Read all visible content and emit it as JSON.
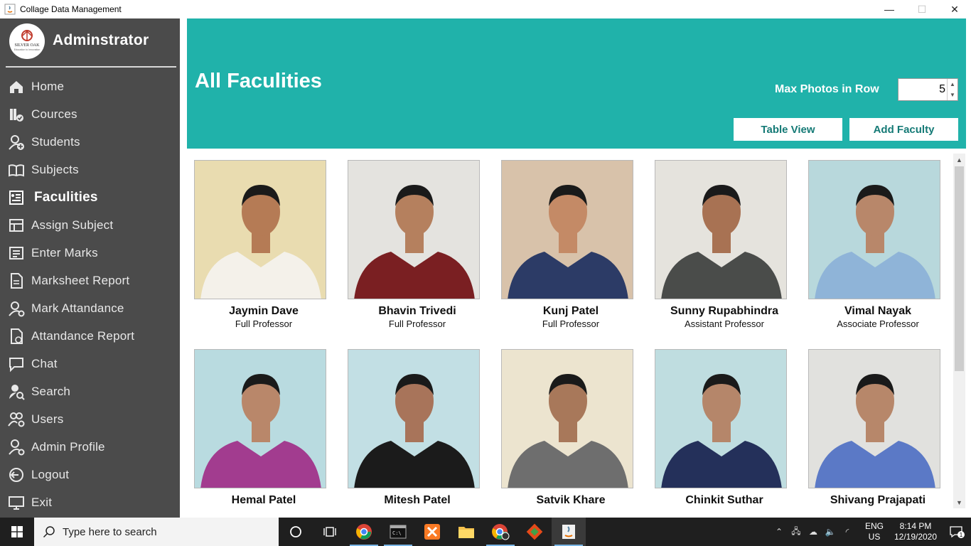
{
  "window": {
    "title": "Collage Data Management",
    "close": "✕",
    "maximize": "☐",
    "minimize": "—"
  },
  "sidebar": {
    "heading": "Adminstrator",
    "items": [
      {
        "label": "Home",
        "icon": "home-icon"
      },
      {
        "label": "Cources",
        "icon": "books-icon"
      },
      {
        "label": "Students",
        "icon": "student-icon"
      },
      {
        "label": "Subjects",
        "icon": "book-open-icon"
      },
      {
        "label": "Faculities",
        "icon": "faculty-icon",
        "active": true
      },
      {
        "label": "Assign Subject",
        "icon": "assign-icon"
      },
      {
        "label": "Enter Marks",
        "icon": "marks-icon"
      },
      {
        "label": "Marksheet Report",
        "icon": "report-icon"
      },
      {
        "label": "Mark Attandance",
        "icon": "attendance-icon"
      },
      {
        "label": "Attandance Report",
        "icon": "attendance-report-icon"
      },
      {
        "label": "Chat",
        "icon": "chat-icon"
      },
      {
        "label": "Search",
        "icon": "search-user-icon"
      },
      {
        "label": "Users",
        "icon": "users-icon"
      },
      {
        "label": "Admin Profile",
        "icon": "admin-profile-icon"
      },
      {
        "label": "Logout",
        "icon": "logout-icon"
      },
      {
        "label": "Exit",
        "icon": "exit-icon"
      }
    ]
  },
  "header": {
    "title": "All Faculities",
    "max_label": "Max Photos in Row",
    "max_value": "5",
    "table_view": "Table View",
    "add_faculty": "Add Faculty",
    "color": "#20b2aa"
  },
  "faculties": [
    {
      "name": "Jaymin Dave",
      "role": "Full Professor",
      "bg": "#e9dcb0",
      "shirt": "#f4f1ea",
      "skin": "#b57b55"
    },
    {
      "name": "Bhavin Trivedi",
      "role": "Full Professor",
      "bg": "#e4e3df",
      "shirt": "#7a1f22",
      "skin": "#b5805e"
    },
    {
      "name": "Kunj Patel",
      "role": "Full Professor",
      "bg": "#d8c2aa",
      "shirt": "#2c3b66",
      "skin": "#c48a66"
    },
    {
      "name": "Sunny Rupabhindra",
      "role": "Assistant Professor",
      "bg": "#e5e3dd",
      "shirt": "#4a4c4a",
      "skin": "#a87253"
    },
    {
      "name": "Vimal Nayak",
      "role": "Associate Professor",
      "bg": "#b8d8dc",
      "shirt": "#8fb4d8",
      "skin": "#b8876a"
    },
    {
      "name": "Hemal Patel",
      "role": "",
      "bg": "#b9dbe0",
      "shirt": "#a23c8f",
      "skin": "#b9876a"
    },
    {
      "name": "Mitesh Patel",
      "role": "",
      "bg": "#c2dfe4",
      "shirt": "#1b1b1b",
      "skin": "#a8745a"
    },
    {
      "name": "Satvik Khare",
      "role": "",
      "bg": "#ece4cf",
      "shirt": "#6e6e6e",
      "skin": "#a8785a"
    },
    {
      "name": "Chinkit Suthar",
      "role": "",
      "bg": "#bfdde0",
      "shirt": "#24305a",
      "skin": "#b5866a"
    },
    {
      "name": "Shivang Prajapati",
      "role": "",
      "bg": "#e1e1de",
      "shirt": "#5b79c6",
      "skin": "#b7876a"
    }
  ],
  "taskbar": {
    "search_placeholder": "Type here to search",
    "lang_top": "ENG",
    "lang_bottom": "US",
    "time": "8:14 PM",
    "date": "12/19/2020",
    "notifications": "1"
  }
}
